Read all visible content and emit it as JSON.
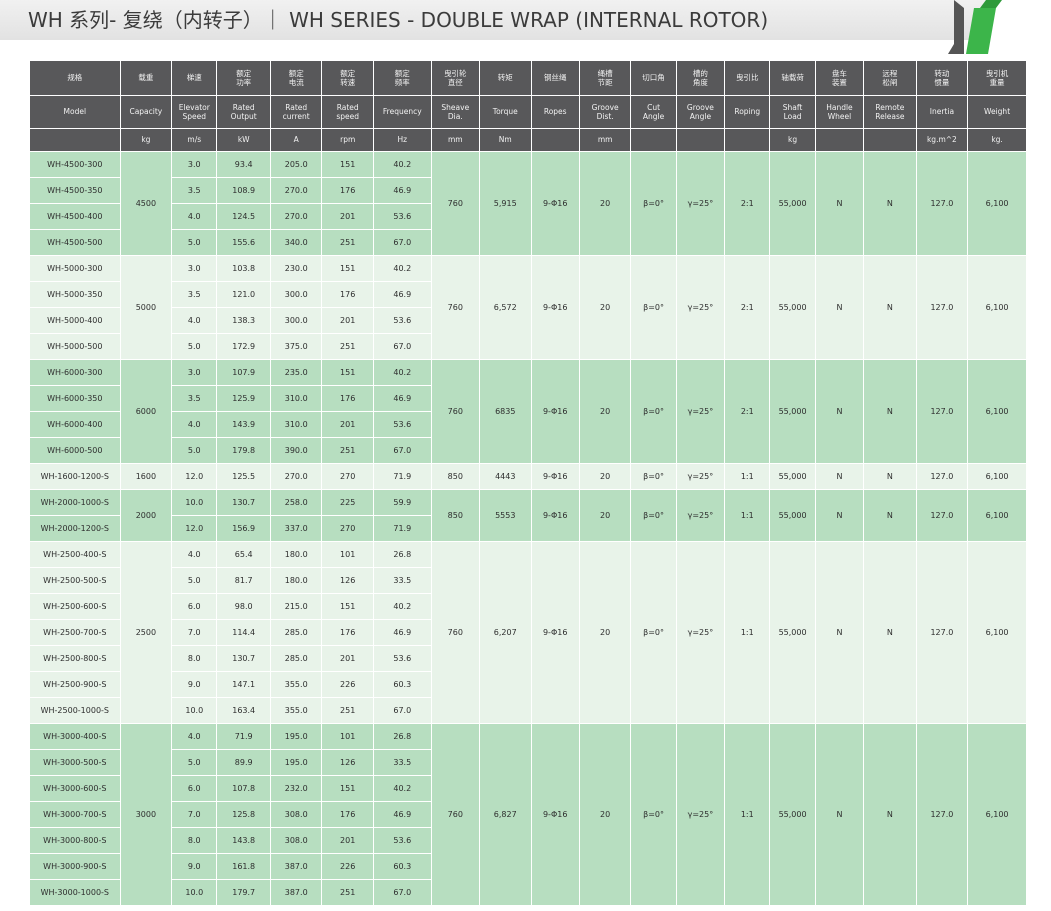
{
  "title": "WH 系列- 复绕（内转子）｜ WH SERIES - DOUBLE WRAP (INTERNAL ROTOR)",
  "colors": {
    "header_bg": "#58585a",
    "row_dark": "#b7dec0",
    "row_light": "#e8f3e9",
    "logo_green": "#3cb54a",
    "logo_gray": "#555555"
  },
  "headers": {
    "cn": [
      "规格",
      "载重",
      "梯速",
      "额定\n功率",
      "额定\n电流",
      "额定\n转速",
      "额定\n频率",
      "曳引轮\n直径",
      "转矩",
      "钢丝绳",
      "绳槽\n节距",
      "切口角",
      "槽的\n角度",
      "曳引比",
      "轴载荷",
      "盘车\n装置",
      "远程\n松闸",
      "转动\n惯量",
      "曳引机\n重量"
    ],
    "en": [
      "Model",
      "Capacity",
      "Elevator\nSpeed",
      "Rated\nOutput",
      "Rated\ncurrent",
      "Rated\nspeed",
      "Frequency",
      "Sheave\nDia.",
      "Torque",
      "Ropes",
      "Groove\nDist.",
      "Cut\nAngle",
      "Groove\nAngle",
      "Roping",
      "Shaft\nLoad",
      "Handle\nWheel",
      "Remote\nRelease",
      "Inertia",
      "Weight"
    ],
    "units": [
      "",
      "kg",
      "m/s",
      "kW",
      "A",
      "rpm",
      "Hz",
      "mm",
      "Nm",
      "",
      "mm",
      "",
      "",
      "",
      "kg",
      "",
      "",
      "kg.m^2",
      "kg."
    ]
  },
  "groups": [
    {
      "capacity": "4500",
      "shared": [
        "760",
        "5,915",
        "9-Φ16",
        "20",
        "β=0°",
        "γ=25°",
        "2:1",
        "55,000",
        "N",
        "N",
        "127.0",
        "6,100"
      ],
      "rows": [
        [
          "WH-4500-300",
          "3.0",
          "93.4",
          "205.0",
          "151",
          "40.2"
        ],
        [
          "WH-4500-350",
          "3.5",
          "108.9",
          "270.0",
          "176",
          "46.9"
        ],
        [
          "WH-4500-400",
          "4.0",
          "124.5",
          "270.0",
          "201",
          "53.6"
        ],
        [
          "WH-4500-500",
          "5.0",
          "155.6",
          "340.0",
          "251",
          "67.0"
        ]
      ]
    },
    {
      "capacity": "5000",
      "shared": [
        "760",
        "6,572",
        "9-Φ16",
        "20",
        "β=0°",
        "γ=25°",
        "2:1",
        "55,000",
        "N",
        "N",
        "127.0",
        "6,100"
      ],
      "rows": [
        [
          "WH-5000-300",
          "3.0",
          "103.8",
          "230.0",
          "151",
          "40.2"
        ],
        [
          "WH-5000-350",
          "3.5",
          "121.0",
          "300.0",
          "176",
          "46.9"
        ],
        [
          "WH-5000-400",
          "4.0",
          "138.3",
          "300.0",
          "201",
          "53.6"
        ],
        [
          "WH-5000-500",
          "5.0",
          "172.9",
          "375.0",
          "251",
          "67.0"
        ]
      ]
    },
    {
      "capacity": "6000",
      "shared": [
        "760",
        "6835",
        "9-Φ16",
        "20",
        "β=0°",
        "γ=25°",
        "2:1",
        "55,000",
        "N",
        "N",
        "127.0",
        "6,100"
      ],
      "rows": [
        [
          "WH-6000-300",
          "3.0",
          "107.9",
          "235.0",
          "151",
          "40.2"
        ],
        [
          "WH-6000-350",
          "3.5",
          "125.9",
          "310.0",
          "176",
          "46.9"
        ],
        [
          "WH-6000-400",
          "4.0",
          "143.9",
          "310.0",
          "201",
          "53.6"
        ],
        [
          "WH-6000-500",
          "5.0",
          "179.8",
          "390.0",
          "251",
          "67.0"
        ]
      ]
    },
    {
      "capacity": "1600",
      "shared": [
        "850",
        "4443",
        "9-Φ16",
        "20",
        "β=0°",
        "γ=25°",
        "1:1",
        "55,000",
        "N",
        "N",
        "127.0",
        "6,100"
      ],
      "rows": [
        [
          "WH-1600-1200-S",
          "12.0",
          "125.5",
          "270.0",
          "270",
          "71.9"
        ]
      ]
    },
    {
      "capacity": "2000",
      "shared": [
        "850",
        "5553",
        "9-Φ16",
        "20",
        "β=0°",
        "γ=25°",
        "1:1",
        "55,000",
        "N",
        "N",
        "127.0",
        "6,100"
      ],
      "rows": [
        [
          "WH-2000-1000-S",
          "10.0",
          "130.7",
          "258.0",
          "225",
          "59.9"
        ],
        [
          "WH-2000-1200-S",
          "12.0",
          "156.9",
          "337.0",
          "270",
          "71.9"
        ]
      ]
    },
    {
      "capacity": "2500",
      "shared": [
        "760",
        "6,207",
        "9-Φ16",
        "20",
        "β=0°",
        "γ=25°",
        "1:1",
        "55,000",
        "N",
        "N",
        "127.0",
        "6,100"
      ],
      "rows": [
        [
          "WH-2500-400-S",
          "4.0",
          "65.4",
          "180.0",
          "101",
          "26.8"
        ],
        [
          "WH-2500-500-S",
          "5.0",
          "81.7",
          "180.0",
          "126",
          "33.5"
        ],
        [
          "WH-2500-600-S",
          "6.0",
          "98.0",
          "215.0",
          "151",
          "40.2"
        ],
        [
          "WH-2500-700-S",
          "7.0",
          "114.4",
          "285.0",
          "176",
          "46.9"
        ],
        [
          "WH-2500-800-S",
          "8.0",
          "130.7",
          "285.0",
          "201",
          "53.6"
        ],
        [
          "WH-2500-900-S",
          "9.0",
          "147.1",
          "355.0",
          "226",
          "60.3"
        ],
        [
          "WH-2500-1000-S",
          "10.0",
          "163.4",
          "355.0",
          "251",
          "67.0"
        ]
      ]
    },
    {
      "capacity": "3000",
      "shared": [
        "760",
        "6,827",
        "9-Φ16",
        "20",
        "β=0°",
        "γ=25°",
        "1:1",
        "55,000",
        "N",
        "N",
        "127.0",
        "6,100"
      ],
      "rows": [
        [
          "WH-3000-400-S",
          "4.0",
          "71.9",
          "195.0",
          "101",
          "26.8"
        ],
        [
          "WH-3000-500-S",
          "5.0",
          "89.9",
          "195.0",
          "126",
          "33.5"
        ],
        [
          "WH-3000-600-S",
          "6.0",
          "107.8",
          "232.0",
          "151",
          "40.2"
        ],
        [
          "WH-3000-700-S",
          "7.0",
          "125.8",
          "308.0",
          "176",
          "46.9"
        ],
        [
          "WH-3000-800-S",
          "8.0",
          "143.8",
          "308.0",
          "201",
          "53.6"
        ],
        [
          "WH-3000-900-S",
          "9.0",
          "161.8",
          "387.0",
          "226",
          "60.3"
        ],
        [
          "WH-3000-1000-S",
          "10.0",
          "179.7",
          "387.0",
          "251",
          "67.0"
        ]
      ]
    }
  ]
}
